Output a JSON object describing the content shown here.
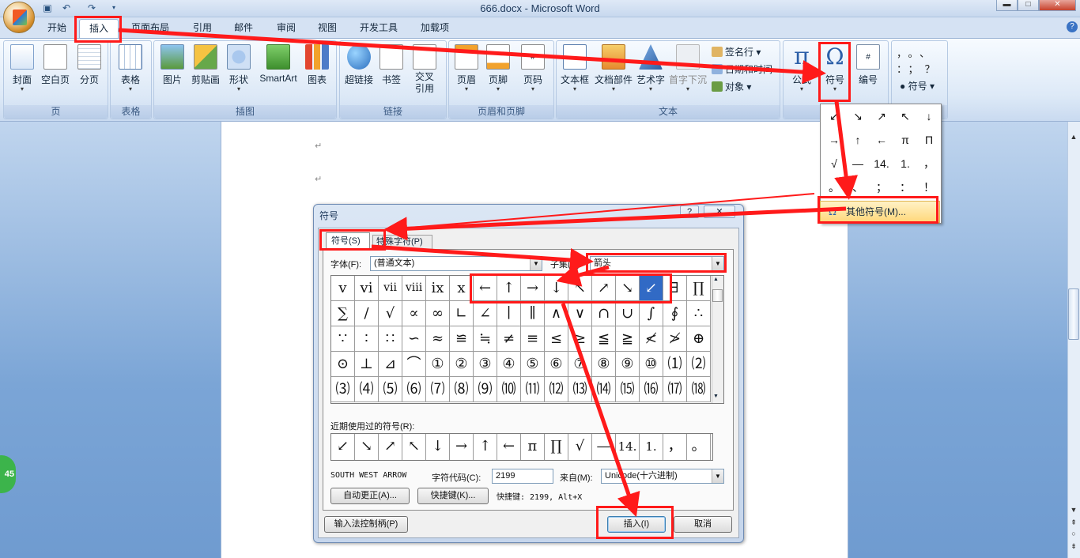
{
  "window": {
    "title": "666.docx - Microsoft Word"
  },
  "quick_access": [
    "save-icon",
    "undo-icon",
    "redo-icon"
  ],
  "tabs": [
    "开始",
    "插入",
    "页面布局",
    "引用",
    "邮件",
    "审阅",
    "视图",
    "开发工具",
    "加载项"
  ],
  "active_tab": "插入",
  "ribbon": {
    "groups": {
      "page": "页",
      "table": "表格",
      "illustrations": "插图",
      "links": "链接",
      "header_footer": "页眉和页脚",
      "text": "文本"
    },
    "buttons": {
      "cover": "封面",
      "blank": "空白页",
      "break": "分页",
      "table": "表格",
      "picture": "图片",
      "clipart": "剪贴画",
      "shapes": "形状",
      "smartart": "SmartArt",
      "chart": "图表",
      "hyperlink": "超链接",
      "bookmark": "书签",
      "crossref_1": "交叉",
      "crossref_2": "引用",
      "header": "页眉",
      "footer": "页脚",
      "pagenum": "页码",
      "textbox": "文本框",
      "quickparts": "文档部件",
      "wordart": "艺术字",
      "dropcap": "首字下沉",
      "signature": "签名行",
      "datetime": "日期和时间",
      "object": "对象",
      "equation": "公式",
      "symbol": "符号",
      "numbering": "编号",
      "special_symbol": "符号"
    },
    "special_chars": [
      "，",
      "。",
      "、",
      "：",
      "；",
      "？"
    ]
  },
  "symbol_dropdown": {
    "cells": [
      "↙",
      "↘",
      "↗",
      "↖",
      "↓",
      "→",
      "↑",
      "←",
      "π",
      "Π",
      "√",
      "—",
      "14.",
      "1.",
      "，",
      "。",
      "、",
      "；",
      "：",
      "！"
    ],
    "more_label": "其他符号(M)..."
  },
  "dialog": {
    "title": "符号",
    "help": "?",
    "close": "✕",
    "tabs": [
      "符号(S)",
      "特殊字符(P)"
    ],
    "font_label": "字体(F):",
    "font_value": "(普通文本)",
    "subset_label": "子集(U)",
    "subset_value": "箭头",
    "grid": [
      [
        "v",
        "vi",
        "vii",
        "viii",
        "ix",
        "x",
        "←",
        "↑",
        "→",
        "↓",
        "↖",
        "↗",
        "↘",
        "↙",
        "∃",
        "∏"
      ],
      [
        "∑",
        "∕",
        "√",
        "∝",
        "∞",
        "∟",
        "∠",
        "∣",
        "∥",
        "∧",
        "∨",
        "∩",
        "∪",
        "∫",
        "∮",
        "∴"
      ],
      [
        "∵",
        "∶",
        "∷",
        "∽",
        "≈",
        "≌",
        "≒",
        "≠",
        "≡",
        "≤",
        "≥",
        "≦",
        "≧",
        "≮",
        "≯",
        "⊕"
      ],
      [
        "⊙",
        "⊥",
        "⊿",
        "⌒",
        "①",
        "②",
        "③",
        "④",
        "⑤",
        "⑥",
        "⑦",
        "⑧",
        "⑨",
        "⑩",
        "⑴",
        "⑵"
      ],
      [
        "⑶",
        "⑷",
        "⑸",
        "⑹",
        "⑺",
        "⑻",
        "⑼",
        "⑽",
        "⑾",
        "⑿",
        "⒀",
        "⒁",
        "⒂",
        "⒃",
        "⒄",
        "⒅"
      ]
    ],
    "selected": {
      "row": 0,
      "col": 13
    },
    "recent_label": "近期使用过的符号(R):",
    "recent": [
      "↙",
      "↘",
      "↗",
      "↖",
      "↓",
      "→",
      "↑",
      "←",
      "п",
      "∏",
      "√",
      "—",
      "14.",
      "1.",
      "，",
      "。"
    ],
    "char_name": "SOUTH WEST ARROW",
    "code_label": "字符代码(C):",
    "code_value": "2199",
    "from_label": "来自(M):",
    "from_value": "Unicode(十六进制)",
    "autocorrect": "自动更正(A)...",
    "shortcut_key": "快捷键(K)...",
    "shortcut_text": "快捷键: 2199, Alt+X",
    "ime_button": "输入法控制柄(P)",
    "insert": "插入(I)",
    "cancel": "取消"
  },
  "badge": "45",
  "colors": {
    "annotation": "#ff1a1a",
    "selected_cell": "#316ac5",
    "ribbon_blue": "#3b5a82"
  }
}
